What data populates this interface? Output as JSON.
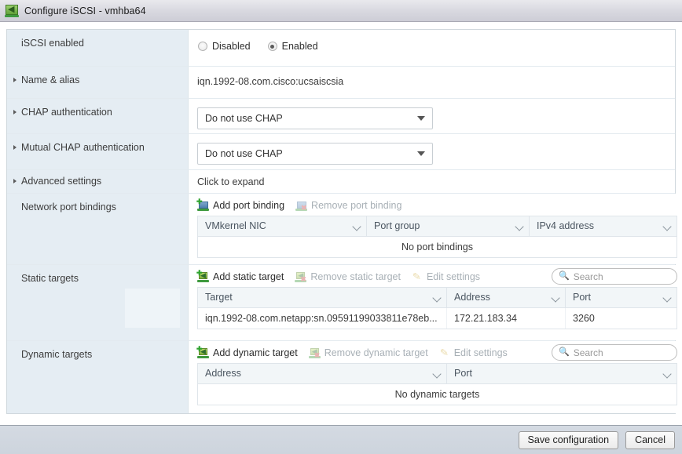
{
  "window": {
    "title": "Configure iSCSI - vmhba64",
    "icon": "iscsi-adapter-icon"
  },
  "form": {
    "rows": [
      {
        "label": "iSCSI enabled",
        "type": "radio",
        "expandable": false,
        "options": [
          {
            "label": "Disabled",
            "checked": false
          },
          {
            "label": "Enabled",
            "checked": true
          }
        ]
      },
      {
        "label": "Name & alias",
        "type": "text",
        "expandable": true,
        "value": "iqn.1992-08.com.cisco:ucsaiscsia"
      },
      {
        "label": "CHAP authentication",
        "type": "select",
        "expandable": true,
        "value": "Do not use CHAP"
      },
      {
        "label": "Mutual CHAP authentication",
        "type": "select",
        "expandable": true,
        "value": "Do not use CHAP"
      },
      {
        "label": "Advanced settings",
        "type": "expand",
        "expandable": true,
        "value": "Click to expand"
      }
    ]
  },
  "port_bindings": {
    "label": "Network port bindings",
    "toolbar": [
      {
        "label": "Add port binding",
        "icon": "add-port-binding-icon",
        "disabled": false
      },
      {
        "label": "Remove port binding",
        "icon": "remove-port-binding-icon",
        "disabled": true
      }
    ],
    "columns": [
      "VMkernel NIC",
      "Port group",
      "IPv4 address"
    ],
    "rows": [],
    "empty_text": "No port bindings"
  },
  "static_targets": {
    "label": "Static targets",
    "toolbar": [
      {
        "label": "Add static target",
        "icon": "add-static-target-icon",
        "disabled": false
      },
      {
        "label": "Remove static target",
        "icon": "remove-static-target-icon",
        "disabled": true
      },
      {
        "label": "Edit settings",
        "icon": "edit-pencil-icon",
        "disabled": true
      }
    ],
    "search_placeholder": "Search",
    "columns": [
      "Target",
      "Address",
      "Port"
    ],
    "rows": [
      {
        "target": "iqn.1992-08.com.netapp:sn.09591199033811e78eb...",
        "address": "172.21.183.34",
        "port": "3260"
      }
    ]
  },
  "dynamic_targets": {
    "label": "Dynamic targets",
    "toolbar": [
      {
        "label": "Add dynamic target",
        "icon": "add-dynamic-target-icon",
        "disabled": false
      },
      {
        "label": "Remove dynamic target",
        "icon": "remove-dynamic-target-icon",
        "disabled": true
      },
      {
        "label": "Edit settings",
        "icon": "edit-pencil-icon",
        "disabled": true
      }
    ],
    "search_placeholder": "Search",
    "columns": [
      "Address",
      "Port"
    ],
    "rows": [],
    "empty_text": "No dynamic targets"
  },
  "footer": {
    "save_label": "Save configuration",
    "cancel_label": "Cancel"
  },
  "colors": {
    "label_bg": "#e5edf3",
    "grid_header_bg": "#f2f6f8",
    "footer_bg": "#d0d7df",
    "titlebar_bg": "#d9d9e0",
    "accent_green": "#3f9a3f"
  }
}
